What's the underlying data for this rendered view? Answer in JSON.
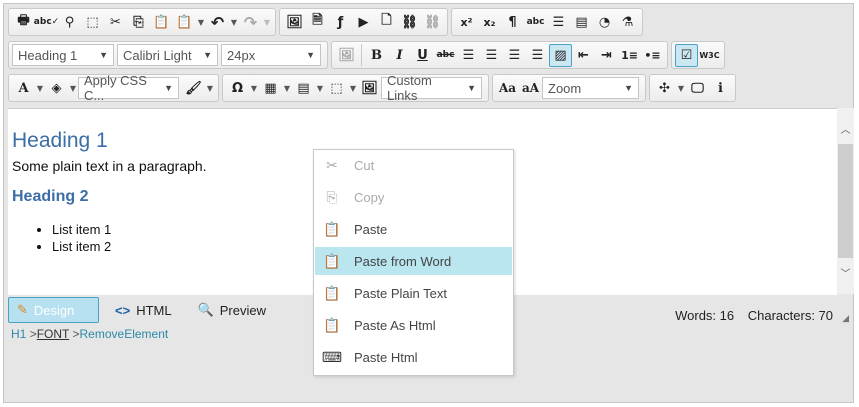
{
  "toolbar": {
    "heading_select": "Heading 1",
    "font_select": "Calibri Light",
    "size_select": "24px",
    "css_select": "Apply CSS C...",
    "links_select": "Custom Links",
    "zoom_select": "Zoom"
  },
  "content": {
    "heading1": "Heading 1",
    "paragraph": "Some plain text in a paragraph.",
    "heading2": "Heading 2",
    "list": [
      "List item 1",
      "List item 2"
    ]
  },
  "modes": {
    "design": "Design",
    "html": "HTML",
    "preview": "Preview"
  },
  "stats": {
    "words": "Words: 16",
    "characters": "Characters: 70"
  },
  "breadcrumb": {
    "h1": "H1",
    "font": "FONT",
    "remove": "RemoveElement"
  },
  "context_menu": {
    "items": [
      "Cut",
      "Copy",
      "Paste",
      "Paste from Word",
      "Paste Plain Text",
      "Paste As Html",
      "Paste Html"
    ],
    "highlighted": "Paste from Word",
    "disabled": [
      "Cut",
      "Copy"
    ]
  },
  "colors": {
    "heading": "#3b6ea5",
    "highlight": "#b9e6ef",
    "active_border": "#4aa3c5"
  }
}
